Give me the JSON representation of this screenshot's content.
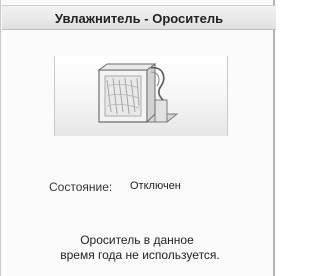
{
  "header": {
    "title": "Увлажнитель - Ороситель"
  },
  "device": {
    "image": "humidifier-cassette-icon"
  },
  "status": {
    "label": "Состояние:",
    "value": "Отключен"
  },
  "note": {
    "line1": "Ороситель в данное",
    "line2": "время года не используется."
  }
}
